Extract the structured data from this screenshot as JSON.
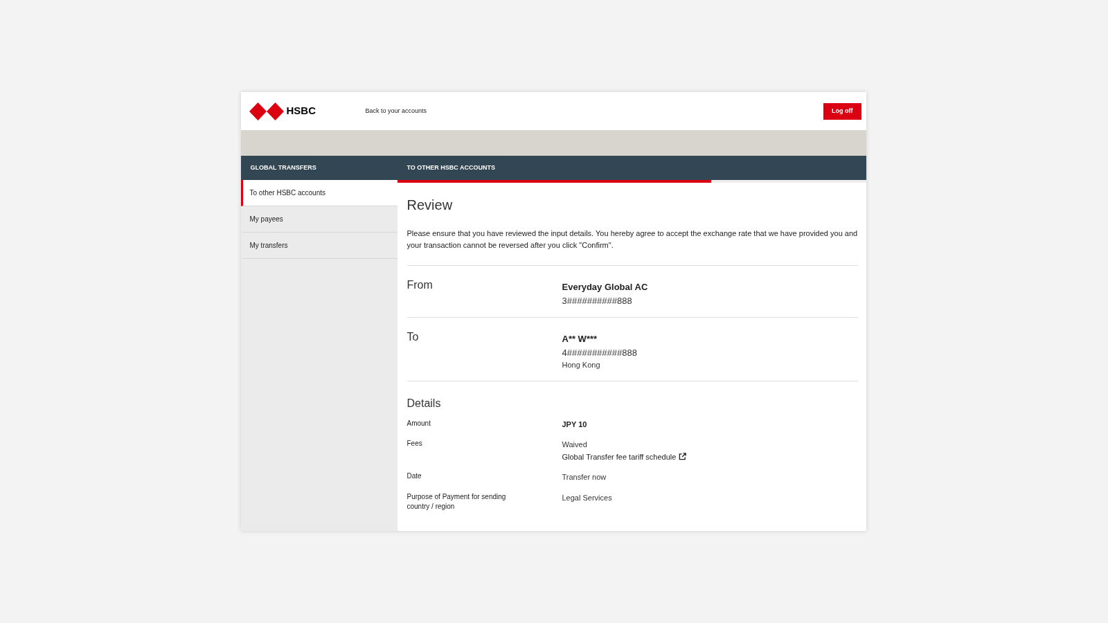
{
  "header": {
    "logo_text": "HSBC",
    "back_link": "Back to your accounts",
    "logoff_button": "Log off"
  },
  "sidebar": {
    "title": "GLOBAL TRANSFERS",
    "items": [
      {
        "label": "To other HSBC accounts",
        "selected": true
      },
      {
        "label": "My payees",
        "selected": false
      },
      {
        "label": "My transfers",
        "selected": false
      }
    ]
  },
  "main": {
    "tab_title": "TO OTHER HSBC ACCOUNTS",
    "progress": {
      "level": 0.67
    },
    "heading": "Review",
    "intro": "Please ensure that you have reviewed the input details. You hereby agree to accept the exchange rate that we have provided you and your transaction cannot be reversed after you click \"Confirm\".",
    "sections": [
      {
        "label": "From",
        "lines": [
          {
            "text": "Everyday Global AC",
            "kind": "bold"
          },
          {
            "text": "3##########888",
            "kind": "plain"
          }
        ]
      },
      {
        "label": "To",
        "lines": [
          {
            "text": "A** W***",
            "kind": "bold"
          },
          {
            "text": "4###########888",
            "kind": "plain"
          },
          {
            "text": "Hong Kong",
            "kind": "small"
          }
        ]
      }
    ],
    "details": {
      "title": "Details",
      "rows": [
        {
          "label": "Amount",
          "lines": [
            {
              "text": "JPY 10",
              "kind": "bold"
            }
          ]
        },
        {
          "label": "Fees",
          "lines": [
            {
              "text": "Waived",
              "kind": "small"
            },
            {
              "text": "Global Transfer fee tariff schedule",
              "kind": "link"
            }
          ]
        },
        {
          "label": "Date",
          "lines": [
            {
              "text": "Transfer now",
              "kind": "small"
            }
          ]
        },
        {
          "label": "Purpose of Payment for sending country / region",
          "lines": [
            {
              "text": "Legal Services",
              "kind": "small"
            }
          ]
        }
      ]
    }
  }
}
